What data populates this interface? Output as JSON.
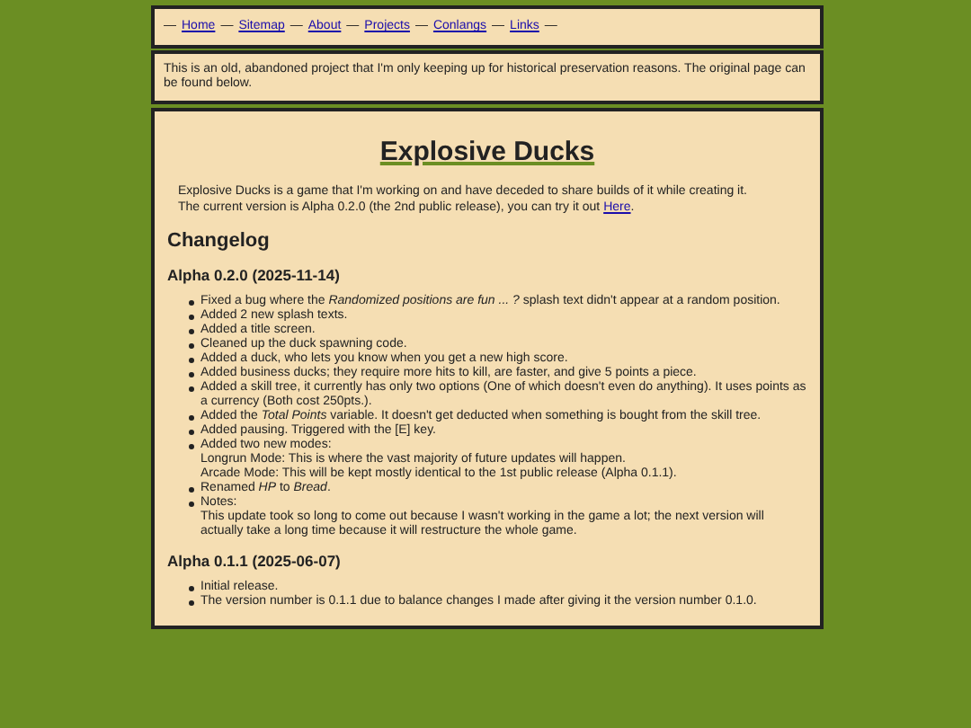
{
  "nav": {
    "separator": "—",
    "links": [
      "Home",
      "Sitemap",
      "About",
      "Projects",
      "Conlangs",
      "Links"
    ]
  },
  "notice": "This is an old, abandoned project that I'm only keeping up for historical preservation reasons. The original page can be found below.",
  "title": "Explosive Ducks",
  "intro": {
    "lines": [
      "Explosive Ducks is a game that I'm working on and have deceded to share builds of it while creating it.",
      "The current version is Alpha 0.2.0 (the 2nd public release), you can try it out"
    ],
    "link": "Here",
    "after": "."
  },
  "changelog": {
    "heading": "Changelog",
    "versions": [
      {
        "title": "Alpha 0.2.0 (2025-11-14)",
        "items": [
          {
            "text": "Fixed a bug where the *Randomized positions are fun ... ?* splash text didn't appear at a random position."
          },
          {
            "text": "Added 2 new splash texts."
          },
          {
            "text": "Added a title screen."
          },
          {
            "text": "Cleaned up the duck spawning code."
          },
          {
            "text": "Added a duck, who lets you know when you get a new high score."
          },
          {
            "text": "Added business ducks; they require more hits to kill, are faster, and give 5 points a piece."
          },
          {
            "text": "Added a skill tree, it currently has only two options (One of which doesn't even do anything). It uses points as a currency (Both cost 250pts.)."
          },
          {
            "text": "Added the *Total Points* variable. It doesn't get deducted when something is bought from the skill tree."
          },
          {
            "text": "Added pausing. Triggered with the [E] key."
          },
          {
            "text": "Added two new modes:",
            "lines": [
              "Longrun Mode: This is where the vast majority of future updates will happen.",
              "Arcade Mode: This will be kept mostly identical to the 1st public release (Alpha 0.1.1)."
            ]
          },
          {
            "text": "Renamed *HP* to *Bread*."
          },
          {
            "text": "Notes:",
            "lines": [
              "This update took so long to come out because I wasn't working in the game a lot; the next version will actually take a long time because it will restructure the whole game."
            ]
          }
        ]
      },
      {
        "title": "Alpha 0.1.1 (2025-06-07)",
        "items": [
          {
            "text": "Initial release."
          },
          {
            "text": "The version number is 0.1.1 due to balance changes I made after giving it the version number 0.1.0."
          }
        ]
      }
    ]
  }
}
